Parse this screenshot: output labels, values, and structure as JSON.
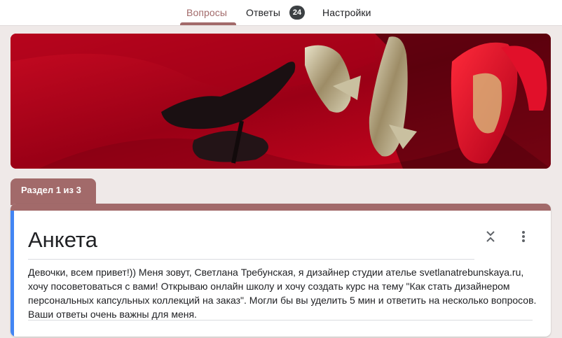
{
  "tabs": {
    "questions": "Вопросы",
    "answers": "Ответы",
    "answers_count": "24",
    "settings": "Настройки"
  },
  "section": {
    "label": "Раздел 1 из 3"
  },
  "form": {
    "title": "Анкета",
    "description": "Девочки, всем привет!)) Меня зовут, Светлана Требунская, я дизайнер студии ателье svetlanatrebunskaya.ru, хочу посоветоваться с вами! Открываю онлайн школу и хочу создать курс на тему \"Как стать дизайнером персональных капсульных коллекций на заказ\". Могли бы вы уделить 5 мин и ответить на несколько вопросов. Ваши ответы очень важны для меня."
  },
  "icons": {
    "collapse": "collapse-icon",
    "more": "more-vert-icon"
  },
  "colors": {
    "accent": "#a26a6a",
    "left_bar": "#4285f4",
    "banner_red": "#b3001b",
    "background": "#efe9e8"
  }
}
